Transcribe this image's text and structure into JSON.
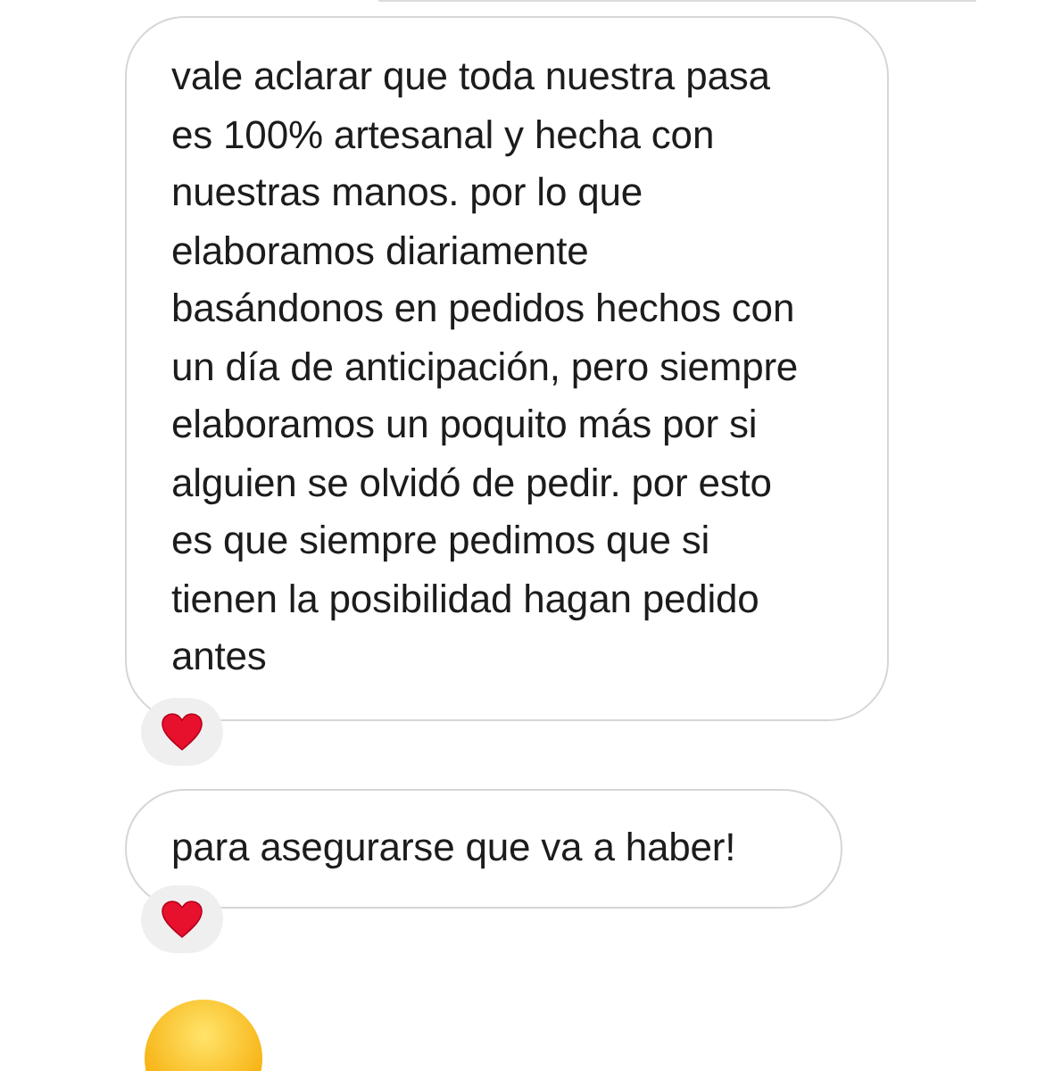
{
  "messages": [
    {
      "kind": "partial"
    },
    {
      "kind": "text",
      "text": "vale aclarar que toda nuestra pasa es 100% artesanal y hecha con nuestras manos. por lo que elaboramos diariamente basándonos en pedidos hechos con un día de anticipación, pero siempre elaboramos un poquito más por si alguien se olvidó de pedir. por esto es que siempre pedimos que si tienen la posibilidad hagan pedido antes",
      "reacted": true
    },
    {
      "kind": "text",
      "text": "para asegurarse que va a haber!",
      "reacted": true
    },
    {
      "kind": "emoji"
    }
  ]
}
